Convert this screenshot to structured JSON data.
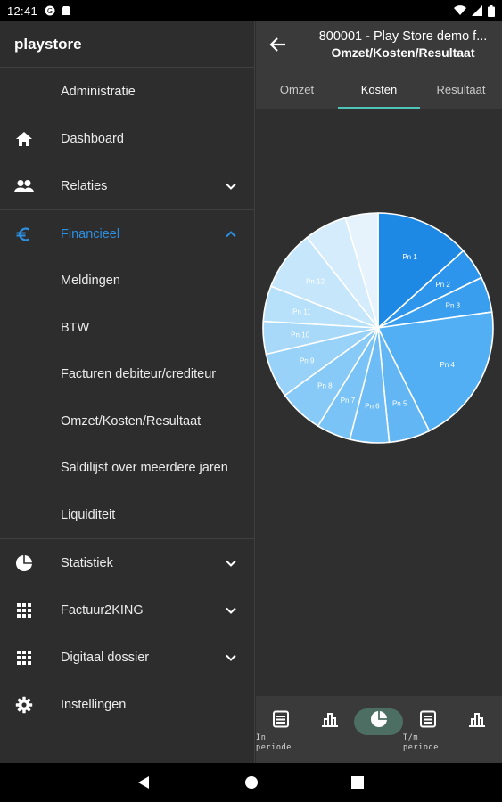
{
  "status_bar": {
    "time": "12:41"
  },
  "drawer": {
    "title": "playstore",
    "header_item": "Administratie",
    "items_top": [
      {
        "label": "Dashboard",
        "icon": "home-icon"
      },
      {
        "label": "Relaties",
        "icon": "people-icon"
      }
    ],
    "financieel": {
      "label": "Financieel",
      "icon": "euro-icon",
      "color": "#2d8fe0"
    },
    "sub_items": [
      "Meldingen",
      "BTW",
      "Facturen debiteur/crediteur",
      "Omzet/Kosten/Resultaat",
      "Saldilijst over meerdere jaren",
      "Liquiditeit"
    ],
    "items_bottom": [
      {
        "label": "Statistiek",
        "icon": "pie-icon"
      },
      {
        "label": "Factuur2KING",
        "icon": "grid-icon"
      },
      {
        "label": "Digitaal dossier",
        "icon": "grid-icon"
      },
      {
        "label": "Instellingen",
        "icon": "gear-icon"
      }
    ]
  },
  "appbar": {
    "line1": "800001 - Play Store demo f...",
    "line2": "Omzet/Kosten/Resultaat"
  },
  "tabs": [
    "Omzet",
    "Kosten",
    "Resultaat"
  ],
  "active_tab": "Kosten",
  "chart_data": {
    "type": "pie",
    "labels": [
      "Pn 1",
      "Pn 2",
      "Pn 3",
      "Pn 4",
      "Pn 5",
      "Pn 6",
      "Pn 7",
      "Pn 8",
      "Pn 9",
      "Pn 10",
      "Pn 11",
      "Pn 12",
      "",
      ""
    ],
    "values": [
      13.3,
      4.5,
      5.0,
      19.9,
      5.8,
      5.5,
      4.8,
      6.3,
      6.3,
      4.6,
      5.0,
      8.5,
      6.0,
      4.6
    ],
    "colors": [
      "#1e88e5",
      "#2e95ec",
      "#3a9eef",
      "#52aff3",
      "#62b6f4",
      "#6ebcf5",
      "#7ac3f6",
      "#88caf7",
      "#98d2f8",
      "#a8d9f9",
      "#b7e0fa",
      "#c5e6fb",
      "#d4ecfc",
      "#e6f3fd"
    ]
  },
  "bottom_nav": {
    "in_periode": "In\nperiode",
    "tm_periode": "T/m\nperiode",
    "active_color": "#4d6e62"
  }
}
